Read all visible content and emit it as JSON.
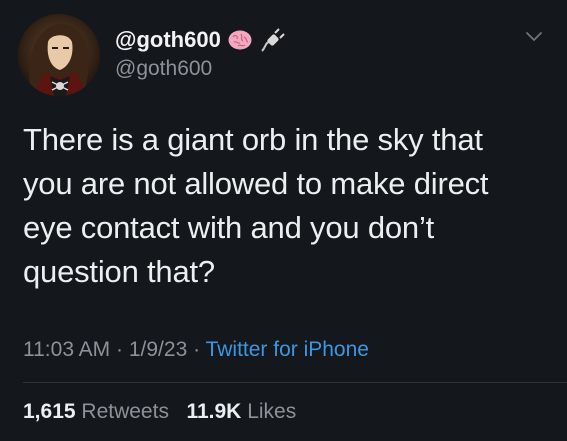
{
  "tweet": {
    "display_name": "@goth600",
    "username": "@goth600",
    "emojis": [
      "brain-icon",
      "electric-plug-icon"
    ],
    "text_lines": [
      "There is a giant orb in the sky that",
      "you are not allowed to make direct",
      "eye contact with and you don’t",
      "question that?"
    ],
    "time": "11:03 AM",
    "date": "1/9/23",
    "separator": "·",
    "source": "Twitter for iPhone",
    "retweets_count": "1,615",
    "retweets_label": "Retweets",
    "likes_count": "11.9K",
    "likes_label": "Likes"
  },
  "colors": {
    "background": "#14171b",
    "text": "#eceff1",
    "secondary": "#8b9299",
    "link": "#3c97e2",
    "divider": "#2f3336"
  }
}
